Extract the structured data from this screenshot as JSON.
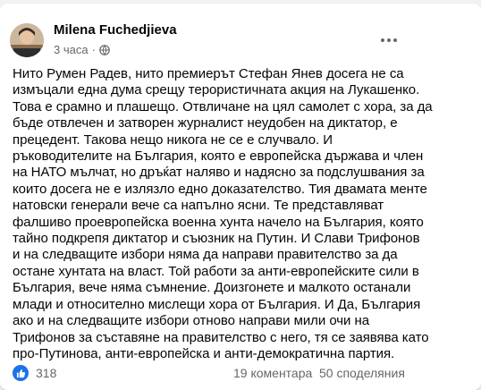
{
  "post": {
    "author": "Milena Fuchedjieva",
    "time": "3 часа",
    "visibility_icon": "globe-icon",
    "menu_icon": "more-horizontal-icon",
    "text": "Нито Румен Радев, нито премиерът Стефан Янев досега не са\nизмъцали една дума срещу терористичната акция на Лукашенко.\nТова е срамно и плашещо. Отвличане на цял самолет с хора, за да\nбъде отвлечен и затворен журналист неудобен на диктатор, е\nпрецедент. Такова нещо никога не се е случвало. И\nръководителите на България, която е европейска държава и член\nна НАТО мълчат, но дръќат наляво и надясно за подслушвания за\nкоито досега не е излязло едно доказателство. Тия двамата менте\nнатовски генерали вече са напълно ясни. Те представляват\nфалшиво проевропейска военна хунта начело на България, която\nтайно подкрепя диктатор и съюзник на Путин. И Слави Трифонов\nи на следващите избори няма да направи правителство за да\nостане хунтата на власт. Той работи за анти-европейските сили в\nБългария, вече няма съмнение. Доизгонете и малкото останали\nмлади и относително мислещи хора от България. И Да, България\nако и на следващите избори отново направи мили очи на\nТрифонов за съставяне на правителство с него, тя се заявява като\nпро-Путинова, анти-европейска и анти-демократична партия."
  },
  "footer": {
    "reaction_icon": "like-icon",
    "reactions": "318",
    "comments": "19 коментара",
    "shares": "50 споделяния"
  },
  "colors": {
    "background": "#f0f2f5",
    "card": "#ffffff",
    "text": "#050505",
    "secondary_text": "#65676b",
    "like_blue": "#1b74e4"
  }
}
